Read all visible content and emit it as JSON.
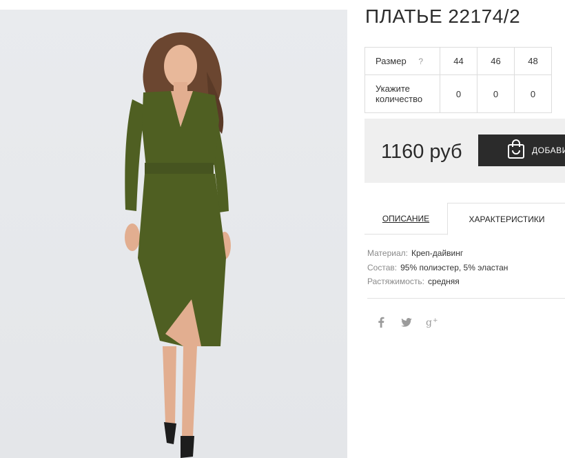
{
  "product": {
    "title": "ПЛАТЬЕ 22174/2",
    "image_alt": "Model in olive green wrap dress"
  },
  "size_table": {
    "size_label": "Размер",
    "help_icon": "?",
    "sizes": [
      "44",
      "46",
      "48"
    ],
    "qty_label_line1": "Укажите",
    "qty_label_line2": "количество",
    "quantities": [
      "0",
      "0",
      "0"
    ]
  },
  "buy": {
    "price": "1160 руб",
    "add_button_label": "ДОБАВИТЬ",
    "add_button_icon": "shopping-bag-icon"
  },
  "tabs": [
    {
      "label": "ОПИСАНИЕ"
    },
    {
      "label": "ХАРАКТЕРИСТИКИ"
    }
  ],
  "specs": [
    {
      "key": "Материал:",
      "value": "Креп-дайвинг"
    },
    {
      "key": "Состав:",
      "value": "95% полиэстер, 5% эластан"
    },
    {
      "key": "Растяжимость:",
      "value": "средняя"
    }
  ],
  "social": [
    {
      "icon": "facebook-icon",
      "glyph": "f"
    },
    {
      "icon": "twitter-icon",
      "glyph": "twitter"
    },
    {
      "icon": "google-plus-icon",
      "glyph": "g+"
    }
  ],
  "colors": {
    "dress": "#4f5f22",
    "button_bg": "#2b2b2b",
    "price_box_bg": "#efefef"
  }
}
